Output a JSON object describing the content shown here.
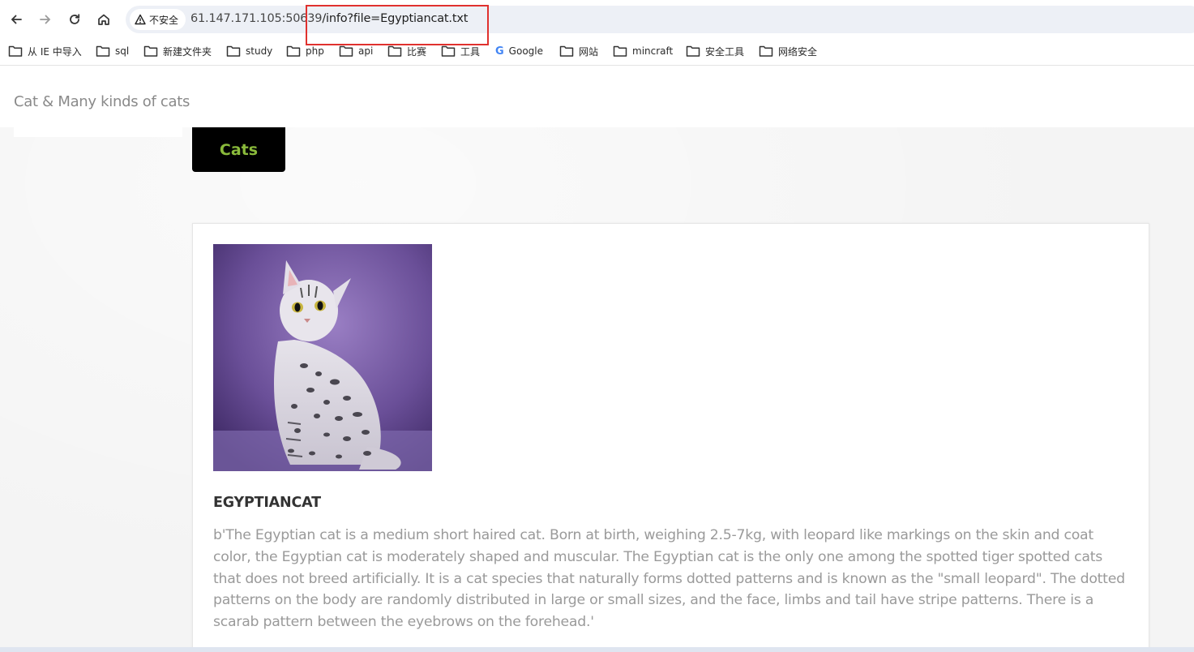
{
  "browser": {
    "security_label": "不安全",
    "url_host": "61.147.171.105:50639",
    "url_path": "/info?file=Egyptiancat.txt"
  },
  "bookmarks": [
    {
      "label": "从 IE 中导入",
      "icon": "folder-icon"
    },
    {
      "label": "sql",
      "icon": "folder-icon"
    },
    {
      "label": "新建文件夹",
      "icon": "folder-icon"
    },
    {
      "label": "study",
      "icon": "folder-icon"
    },
    {
      "label": "php",
      "icon": "folder-icon"
    },
    {
      "label": "api",
      "icon": "folder-icon"
    },
    {
      "label": "比赛",
      "icon": "folder-icon"
    },
    {
      "label": "工具",
      "icon": "folder-icon"
    },
    {
      "label": "Google",
      "icon": "google-icon"
    },
    {
      "label": "网站",
      "icon": "folder-icon"
    },
    {
      "label": "mincraft",
      "icon": "folder-icon"
    },
    {
      "label": "安全工具",
      "icon": "folder-icon"
    },
    {
      "label": "网络安全",
      "icon": "folder-icon"
    }
  ],
  "site": {
    "title": "Cat & Many kinds of cats",
    "nav_button": "Cats"
  },
  "cat": {
    "name": "EGYPTIANCAT",
    "description": "b'The Egyptian cat is a medium short haired cat. Born at birth, weighing 2.5-7kg, with leopard like markings on the skin and coat color, the Egyptian cat is moderately shaped and muscular. The Egyptian cat is the only one among the spotted tiger spotted cats that does not breed artificially. It is a cat species that naturally forms dotted patterns and is known as the \"small leopard\". The dotted patterns on the body are randomly distributed in large or small sizes, and the face, limbs and tail have stripe patterns. There is a scarab pattern between the eyebrows on the forehead.'"
  },
  "colors": {
    "accent_green": "#8aba3b",
    "highlight_red": "#e0312e"
  }
}
